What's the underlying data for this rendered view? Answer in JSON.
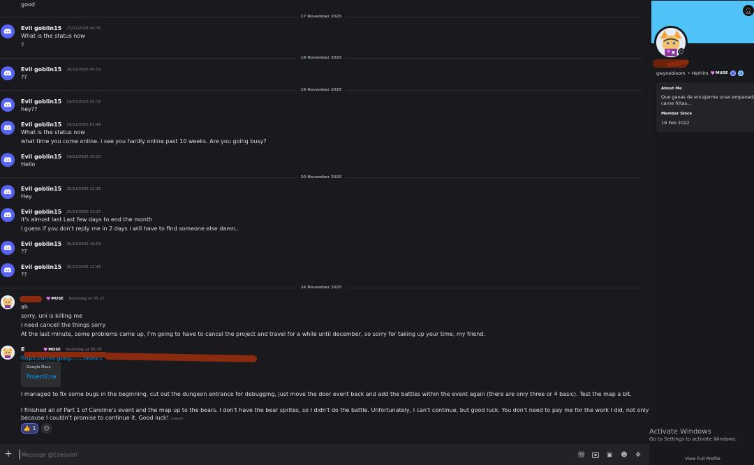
{
  "chat": {
    "lines_top": [
      {
        "text": "good"
      }
    ],
    "dividers": [
      {
        "text": "17 November 2025"
      },
      {
        "text": "18 November 2025"
      },
      {
        "text": "19 November 2025"
      },
      {
        "text": "20 November 2025"
      },
      {
        "text": "24 November 2025"
      }
    ],
    "messages": [
      {
        "author": "Evil goblin15",
        "time": "17/11/2025 00:35",
        "lines": [
          "What is the status now",
          "?"
        ]
      },
      {
        "author": "Evil goblin15",
        "time": "18/11/2025 00:52",
        "lines": [
          "??"
        ]
      },
      {
        "author": "Evil goblin15",
        "time": "19/11/2025 01:31",
        "lines": [
          "hey??"
        ]
      },
      {
        "author": "Evil goblin15",
        "time": "19/11/2025 01:49",
        "lines": [
          "What is the status now",
          "what time you come online. i see you hardly online past 10 weeks. Are you going busy?"
        ]
      },
      {
        "author": "Evil goblin15",
        "time": "19/11/2025 20:20",
        "lines": [
          "Hello"
        ]
      },
      {
        "author": "Evil goblin15",
        "time": "20/11/2025 12:16",
        "lines": [
          "Hey"
        ]
      },
      {
        "author": "Evil goblin15",
        "time": "20/11/2025 13:17",
        "lines": [
          "it's almost last Last few days to end the month",
          "i guess if you don't reply me in 2 days i will have to find someone else damn.."
        ]
      },
      {
        "author": "Evil goblin15",
        "time": "20/11/2025 18:53",
        "lines": [
          "??"
        ]
      },
      {
        "author": "Evil goblin15",
        "time": "20/11/2025 22:49",
        "lines": [
          "??"
        ]
      },
      {
        "author": "",
        "tag": "MUSE",
        "time": "Yesterday at 05:27",
        "lines": [
          "ah",
          "sorry, uni is killing me",
          "i need cancell the things sorry",
          "At the last minute, some problems came up, I'm going to have to cancel the project and travel for a while until december, so sorry for taking up your time, my friend."
        ]
      },
      {
        "author": "E",
        "tag": "MUSE",
        "time": "Yesterday at 05:39",
        "link": "https://drive.goog.......file/d/1",
        "embed_provider": "Google Docs",
        "embed_title": "Project2.rar",
        "lines": [
          "I managed to fix some bugs in the beginning, cut out the dungeon entrance for debugging, just move the door event back and add the battles within the event again (there are only three or 4 basic). Test the map a bit.",
          "I finished all of Part 1 of Caroline's event and the map up to the bears. I don't have the bear sprites, so I didn't do the battle. Unfortunately, I can't continue, but good luck. You don't need to pay me for the work I did, not only because it's incomplete but also",
          "because I couldn't promise to continue it. Good luck!"
        ],
        "edited": "(edited)",
        "reaction_emoji": "👍",
        "reaction_count": "1",
        "add_reaction_icon": "😊"
      }
    ]
  },
  "composer": {
    "placeholder": "Message @Ezequiel"
  },
  "profile": {
    "handle": "gwynebloom",
    "pronouns": "• He/Him",
    "tag": "MUSE",
    "about_label": "About Me",
    "about_text_1": "Que ganas de encajarme unas empanadas de",
    "about_text_2": "carne fritas...",
    "member_since_label": "Member Since",
    "member_since": "19 Feb 2022",
    "view_full": "View Full Profile",
    "banner_color": "#4fc3f7"
  },
  "overlay": {
    "title": "Activate Windows",
    "subtitle": "Go to Settings to activate Windows."
  }
}
